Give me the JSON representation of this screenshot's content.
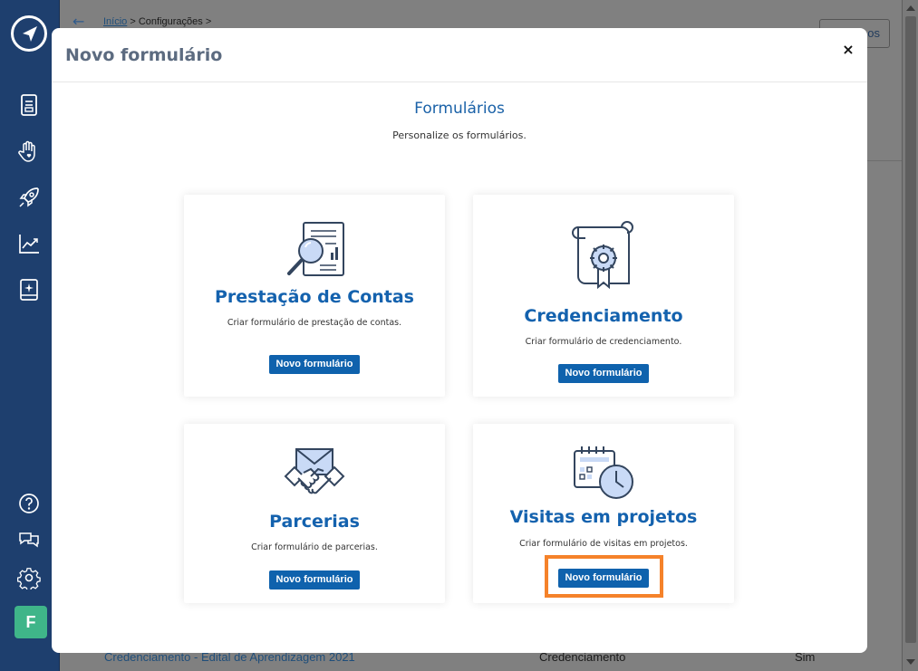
{
  "background_page": {
    "breadcrumb": {
      "home": "Início",
      "separator": ">",
      "current": "Configurações",
      "trail_separator": ">"
    },
    "header_button_visible": "os",
    "row": {
      "name": "Credenciamento - Edital de Aprendizagem 2021",
      "type": "Credenciamento",
      "status": "Sim"
    }
  },
  "sidebar": {
    "avatar_letter": "F"
  },
  "modal": {
    "title": "Novo formulário",
    "close_label": "×",
    "section_title": "Formulários",
    "section_subtitle": "Personalize os formulários.",
    "cards": [
      {
        "title": "Prestação de Contas",
        "description": "Criar formulário de prestação de contas.",
        "button": "Novo formulário",
        "icon": "audit-report-icon"
      },
      {
        "title": "Credenciamento",
        "description": "Criar formulário de credenciamento.",
        "button": "Novo formulário",
        "icon": "certificate-icon"
      },
      {
        "title": "Parcerias",
        "description": "Criar formulário de parcerias.",
        "button": "Novo formulário",
        "icon": "handshake-icon"
      },
      {
        "title": "Visitas em projetos",
        "description": "Criar formulário de visitas em projetos.",
        "button": "Novo formulário",
        "icon": "calendar-clock-icon"
      }
    ]
  },
  "colors": {
    "accent": "#1462ae",
    "button": "#0f62ad",
    "sidebar": "#1e3f6e",
    "highlight": "#f5822a",
    "avatar": "#3fb589"
  }
}
